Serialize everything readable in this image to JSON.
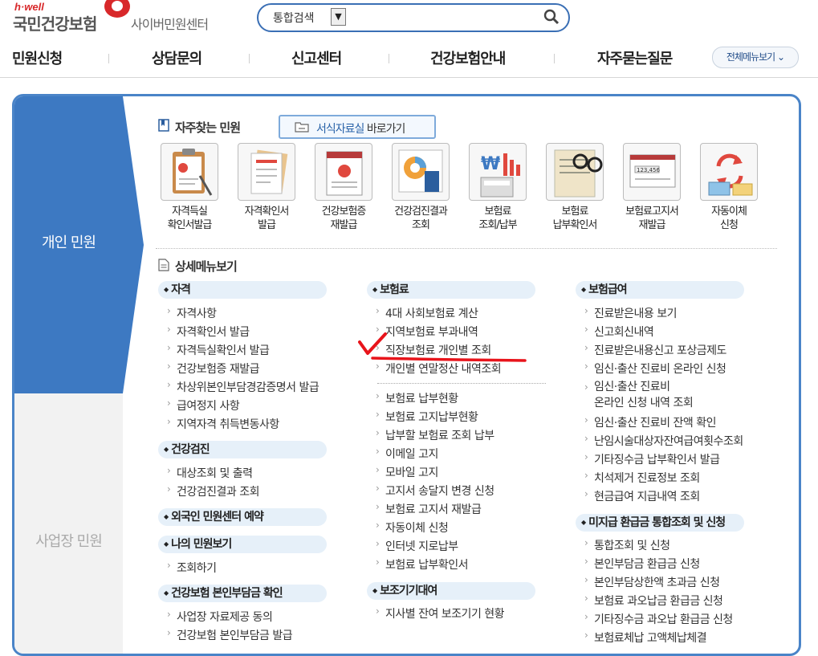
{
  "header": {
    "brand_hwell": "h·well",
    "brand_name": "국민건강보험",
    "brand_sub": "사이버민원센터",
    "search": {
      "scope": "통합검색",
      "placeholder": "",
      "value": ""
    },
    "gnb": [
      "민원신청",
      "상담문의",
      "신고센터",
      "건강보험안내",
      "자주묻는질문"
    ],
    "all_menu": "전체메뉴보기"
  },
  "tabs": {
    "personal": "개인 민원",
    "business": "사업장 민원"
  },
  "frequent": {
    "title": "자주찾는 민원",
    "forms_button_blue": "서식자료실",
    "forms_button_rest": " 바로가기",
    "items": [
      {
        "label": "자격득실\n확인서발급",
        "icon": "clipboard-icon"
      },
      {
        "label": "자격확인서\n발급",
        "icon": "document-icon"
      },
      {
        "label": "건강보험증\n재발급",
        "icon": "health-card-icon"
      },
      {
        "label": "건강검진결과\n조회",
        "icon": "checkup-chart-icon"
      },
      {
        "label": "보험료\n조회/납부",
        "icon": "won-calculator-icon"
      },
      {
        "label": "보험료\n납부확인서",
        "icon": "receipt-glasses-icon"
      },
      {
        "label": "보험료고지서\n재발급",
        "icon": "bill-icon"
      },
      {
        "label": "자동이체\n신청",
        "icon": "auto-transfer-icon"
      }
    ]
  },
  "detail": {
    "title": "상세메뉴보기",
    "col1": [
      {
        "category": "자격",
        "items": [
          "자격사항",
          "자격확인서 발급",
          "자격득실확인서 발급",
          "건강보험증 재발급",
          "차상위본인부담경감증명서 발급",
          "급여정지 사항",
          "지역자격 취득변동사항"
        ]
      },
      {
        "category": "건강검진",
        "items": [
          "대상조회 및 출력",
          "건강검진결과 조회"
        ]
      },
      {
        "category": "외국인 민원센터 예약",
        "items": []
      },
      {
        "category": "나의 민원보기",
        "items": [
          "조회하기"
        ]
      },
      {
        "category": "건강보험 본인부담금 확인",
        "items": [
          "사업장 자료제공 동의",
          "건강보험 본인부담금 발급"
        ]
      }
    ],
    "col2": [
      {
        "category": "보험료",
        "items": [
          "4대 사회보험료 계산",
          "지역보험료 부과내역",
          "직장보험료 개인별 조회",
          "개인별 연말정산 내역조회"
        ],
        "items2": [
          "보험료 납부현황",
          "보험료 고지납부현황",
          "납부할 보험료 조회 납부",
          "이메일 고지",
          "모바일 고지",
          "고지서 송달지 변경 신청",
          "보험료 고지서 재발급",
          "자동이체 신청",
          "인터넷 지로납부",
          "보험료 납부확인서"
        ]
      },
      {
        "category": "보조기기대여",
        "items": [
          "지사별 잔여 보조기기 현황"
        ]
      }
    ],
    "col3": [
      {
        "category": "보험급여",
        "items": [
          "진료받은내용 보기",
          "신고회신내역",
          "진료받은내용신고 포상금제도",
          "임신·출산 진료비 온라인 신청",
          "임신·출산 진료비\n온라인 신청 내역 조회",
          "임신·출산 진료비 잔액 확인",
          "난임시술대상자잔여급여횟수조회",
          "기타징수금 납부확인서 발급",
          "치석제거 진료정보 조회",
          "현금급여 지급내역 조회"
        ]
      },
      {
        "category": "미지급 환급금 통합조회 및 신청",
        "items": [
          "통합조회 및 신청",
          "본인부담금 환급금 신청",
          "본인부담상한액 초과금 신청",
          "보험료 과오납금 환급금 신청",
          "기타징수금 과오납 환급금 신청",
          "보험료체납 고액체납체결"
        ]
      }
    ]
  },
  "colors": {
    "primary_blue": "#3d79c2",
    "annotation_red": "#e8141b"
  }
}
